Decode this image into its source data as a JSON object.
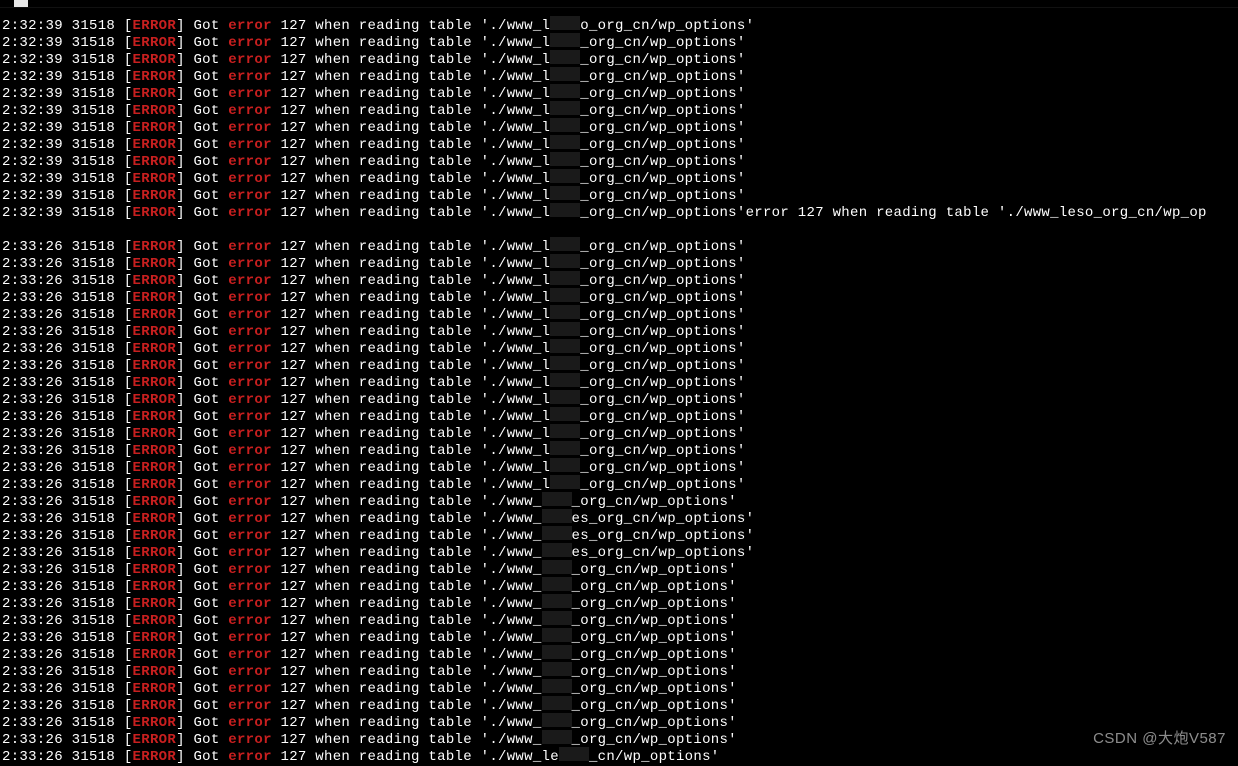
{
  "watermark": "CSDN @大炮V587",
  "log": {
    "pid": "31518",
    "level": "ERROR",
    "got": "Got",
    "err_word": "error",
    "code": "127",
    "action": "when reading table",
    "path_pre": "'./www_l",
    "path_pre_alt": "'./www_",
    "path_pre_le": "'./www_le",
    "path_post": "_org_cn/wp_options'",
    "path_post_o": "o_org_cn/wp_options'",
    "path_post_cn": "_cn/wp_options'",
    "path_post_es": "es_org_cn/wp_options'",
    "overflow_tail": "error 127 when reading table './www_leso_org_cn/wp_op",
    "t1": "2:32:39",
    "t2": "2:33:26"
  },
  "lines": [
    {
      "t": "t1",
      "pre": "path_pre",
      "post": "path_post_o"
    },
    {
      "t": "t1",
      "pre": "path_pre",
      "post": "path_post"
    },
    {
      "t": "t1",
      "pre": "path_pre",
      "post": "path_post"
    },
    {
      "t": "t1",
      "pre": "path_pre",
      "post": "path_post"
    },
    {
      "t": "t1",
      "pre": "path_pre",
      "post": "path_post"
    },
    {
      "t": "t1",
      "pre": "path_pre",
      "post": "path_post"
    },
    {
      "t": "t1",
      "pre": "path_pre",
      "post": "path_post"
    },
    {
      "t": "t1",
      "pre": "path_pre",
      "post": "path_post"
    },
    {
      "t": "t1",
      "pre": "path_pre",
      "post": "path_post"
    },
    {
      "t": "t1",
      "pre": "path_pre",
      "post": "path_post"
    },
    {
      "t": "t1",
      "pre": "path_pre",
      "post": "path_post"
    },
    {
      "t": "t1",
      "pre": "path_pre",
      "post": "path_post",
      "tail": true
    },
    {
      "blank": true
    },
    {
      "t": "t2",
      "pre": "path_pre",
      "post": "path_post"
    },
    {
      "t": "t2",
      "pre": "path_pre",
      "post": "path_post"
    },
    {
      "t": "t2",
      "pre": "path_pre",
      "post": "path_post"
    },
    {
      "t": "t2",
      "pre": "path_pre",
      "post": "path_post"
    },
    {
      "t": "t2",
      "pre": "path_pre",
      "post": "path_post"
    },
    {
      "t": "t2",
      "pre": "path_pre",
      "post": "path_post"
    },
    {
      "t": "t2",
      "pre": "path_pre",
      "post": "path_post"
    },
    {
      "t": "t2",
      "pre": "path_pre",
      "post": "path_post"
    },
    {
      "t": "t2",
      "pre": "path_pre",
      "post": "path_post"
    },
    {
      "t": "t2",
      "pre": "path_pre",
      "post": "path_post"
    },
    {
      "t": "t2",
      "pre": "path_pre",
      "post": "path_post"
    },
    {
      "t": "t2",
      "pre": "path_pre",
      "post": "path_post"
    },
    {
      "t": "t2",
      "pre": "path_pre",
      "post": "path_post"
    },
    {
      "t": "t2",
      "pre": "path_pre",
      "post": "path_post"
    },
    {
      "t": "t2",
      "pre": "path_pre",
      "post": "path_post"
    },
    {
      "t": "t2",
      "pre": "path_pre_alt",
      "post": "path_post"
    },
    {
      "t": "t2",
      "pre": "path_pre_alt",
      "post": "path_post_es"
    },
    {
      "t": "t2",
      "pre": "path_pre_alt",
      "post": "path_post_es"
    },
    {
      "t": "t2",
      "pre": "path_pre_alt",
      "post": "path_post_es"
    },
    {
      "t": "t2",
      "pre": "path_pre_alt",
      "post": "path_post"
    },
    {
      "t": "t2",
      "pre": "path_pre_alt",
      "post": "path_post"
    },
    {
      "t": "t2",
      "pre": "path_pre_alt",
      "post": "path_post"
    },
    {
      "t": "t2",
      "pre": "path_pre_alt",
      "post": "path_post"
    },
    {
      "t": "t2",
      "pre": "path_pre_alt",
      "post": "path_post"
    },
    {
      "t": "t2",
      "pre": "path_pre_alt",
      "post": "path_post"
    },
    {
      "t": "t2",
      "pre": "path_pre_alt",
      "post": "path_post"
    },
    {
      "t": "t2",
      "pre": "path_pre_alt",
      "post": "path_post"
    },
    {
      "t": "t2",
      "pre": "path_pre_alt",
      "post": "path_post"
    },
    {
      "t": "t2",
      "pre": "path_pre_alt",
      "post": "path_post"
    },
    {
      "t": "t2",
      "pre": "path_pre_alt",
      "post": "path_post"
    },
    {
      "t": "t2",
      "pre": "path_pre_le",
      "post": "path_post_cn"
    }
  ]
}
